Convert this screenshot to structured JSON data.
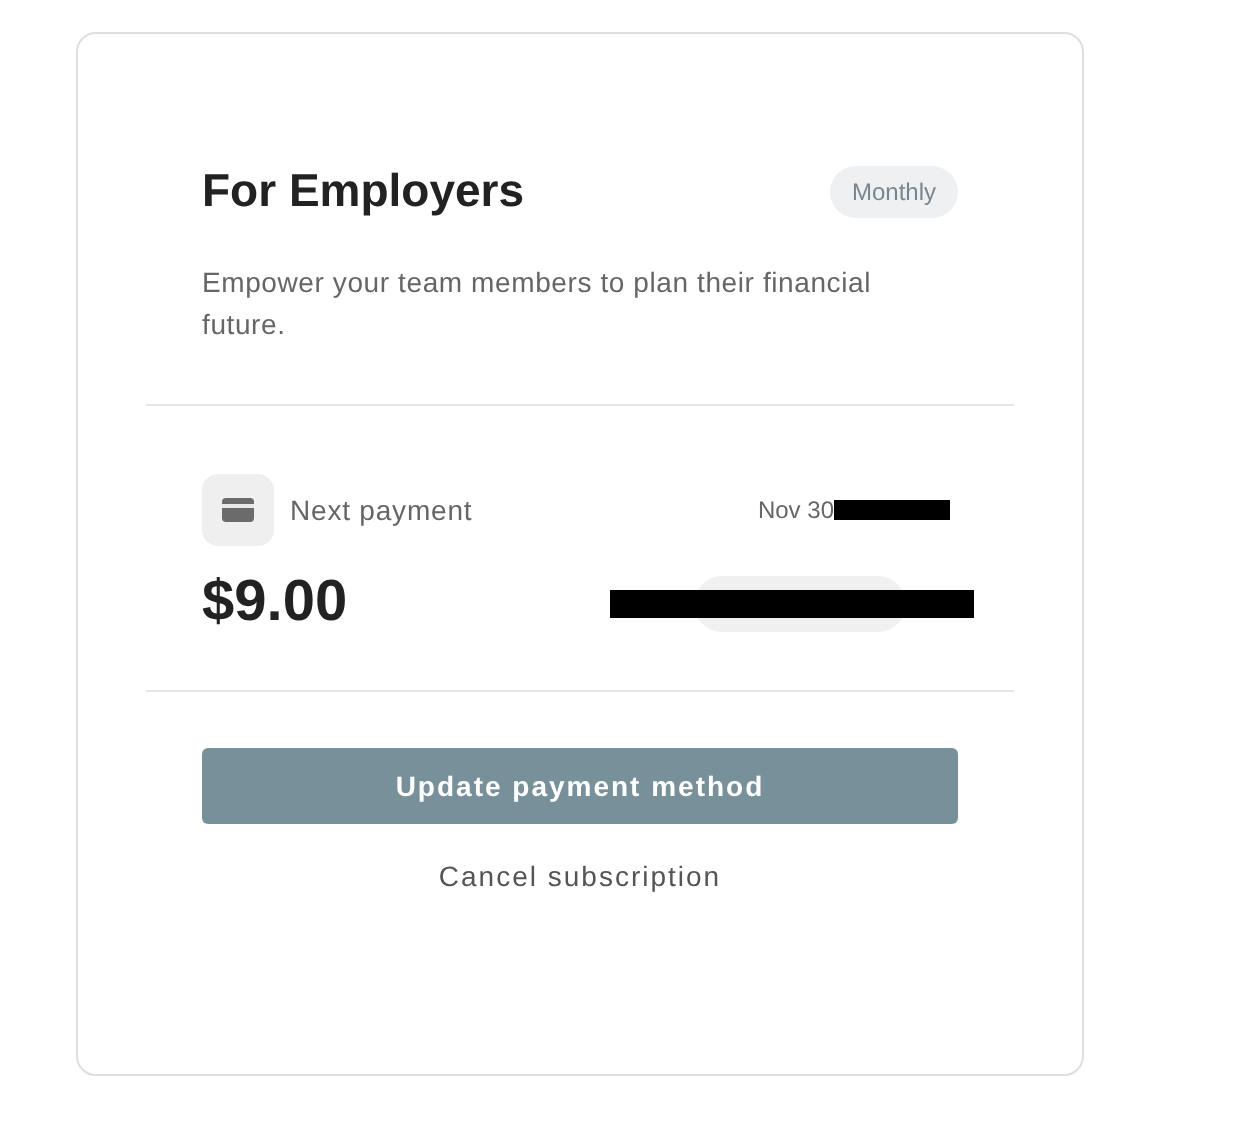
{
  "plan": {
    "title": "For Employers",
    "badge": "Monthly",
    "description": "Empower your team members to plan their financial future."
  },
  "payment": {
    "label": "Next payment",
    "date": "Nov 30",
    "amount": "$9.00"
  },
  "buttons": {
    "primary": "Update payment method",
    "secondary": "Cancel subscription"
  }
}
